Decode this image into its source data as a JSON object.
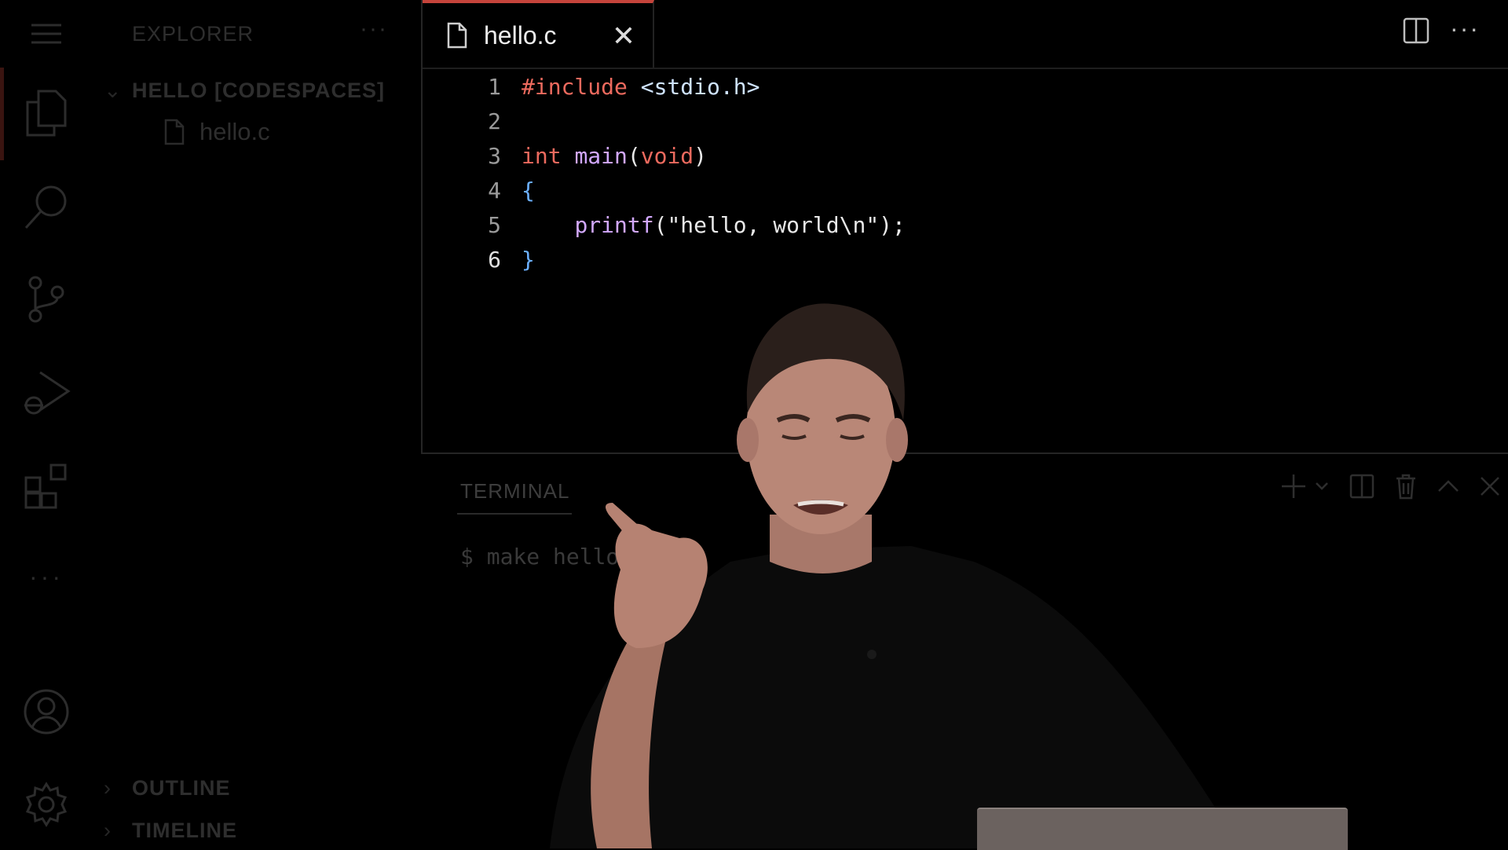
{
  "activity_bar": {
    "items": [
      "explorer-icon",
      "search-icon",
      "source-control-icon",
      "run-debug-icon",
      "extensions-icon",
      "more-icon"
    ],
    "more_label": "···",
    "bottom_items": [
      "account-icon",
      "settings-icon"
    ]
  },
  "sidebar": {
    "title": "EXPLORER",
    "more_label": "···",
    "workspace": "HELLO [CODESPACES]",
    "files": [
      "hello.c"
    ],
    "sections": [
      "OUTLINE",
      "TIMELINE"
    ]
  },
  "editor": {
    "tab_label": "hello.c",
    "close_label": "✕",
    "more_label": "···",
    "active_tab_color": "#c5443b",
    "code_lines": [
      {
        "number": "1",
        "text": "#include <stdio.h>"
      },
      {
        "number": "2",
        "text": ""
      },
      {
        "number": "3",
        "text": "int main(void)"
      },
      {
        "number": "4",
        "text": "{"
      },
      {
        "number": "5",
        "text": "    printf(\"hello, world\\n\");"
      },
      {
        "number": "6",
        "text": "}"
      }
    ]
  },
  "terminal": {
    "tab_label": "TERMINAL",
    "prompt": "$",
    "command": "make hello",
    "actions": [
      "plus-icon",
      "chevron-down-icon",
      "split-terminal-icon",
      "trash-icon",
      "chevron-up-icon",
      "close-icon"
    ]
  }
}
